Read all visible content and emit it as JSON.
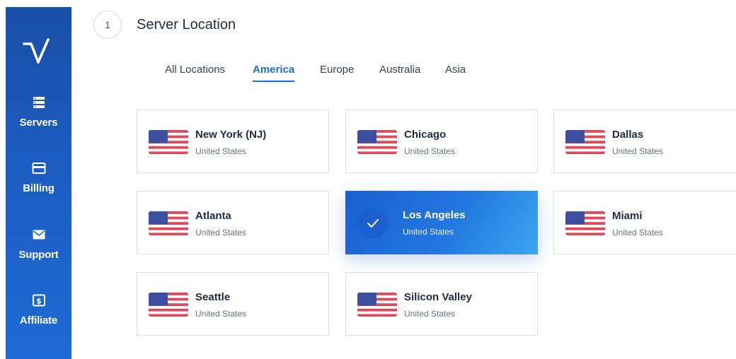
{
  "sidebar": {
    "items": [
      {
        "label": "Servers",
        "icon": "server-icon"
      },
      {
        "label": "Billing",
        "icon": "credit-card-icon"
      },
      {
        "label": "Support",
        "icon": "envelope-icon"
      },
      {
        "label": "Affiliate",
        "icon": "dollar-icon"
      }
    ]
  },
  "header": {
    "step": "1",
    "title": "Server Location"
  },
  "tabs": [
    {
      "label": "All Locations",
      "active": false
    },
    {
      "label": "America",
      "active": true
    },
    {
      "label": "Europe",
      "active": false
    },
    {
      "label": "Australia",
      "active": false
    },
    {
      "label": "Asia",
      "active": false
    }
  ],
  "locations": [
    {
      "name": "New York (NJ)",
      "country": "United States",
      "selected": false
    },
    {
      "name": "Chicago",
      "country": "United States",
      "selected": false
    },
    {
      "name": "Dallas",
      "country": "United States",
      "selected": false
    },
    {
      "name": "Atlanta",
      "country": "United States",
      "selected": false
    },
    {
      "name": "Los Angeles",
      "country": "United States",
      "selected": true
    },
    {
      "name": "Miami",
      "country": "United States",
      "selected": false
    },
    {
      "name": "Seattle",
      "country": "United States",
      "selected": false
    },
    {
      "name": "Silicon Valley",
      "country": "United States",
      "selected": false
    }
  ],
  "colors": {
    "accent": "#1a6fd4",
    "sidebar": "#1c5fc6",
    "selected_card": "#2277e0"
  }
}
